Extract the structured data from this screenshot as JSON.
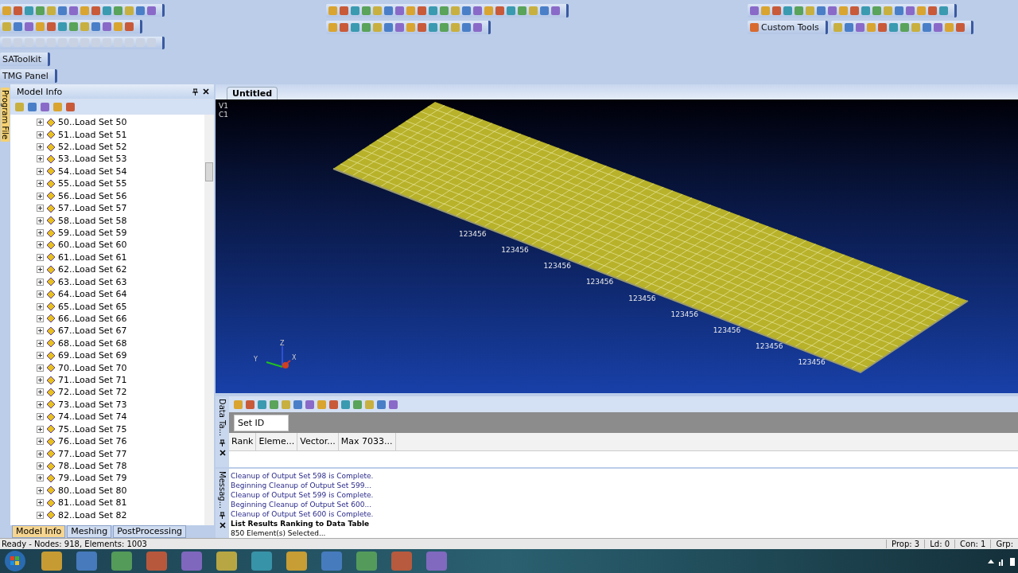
{
  "toolbars": {
    "panels": [
      "SAToolkit",
      "TMG Panel"
    ],
    "custom_tools": "Custom Tools"
  },
  "side_tab": "Program File",
  "model_info": {
    "title": "Model Info",
    "tree": [
      {
        "label": "50..Load Set 50",
        "expanded": false
      },
      {
        "label": "51..Load Set 51",
        "expanded": false
      },
      {
        "label": "52..Load Set 52",
        "expanded": false
      },
      {
        "label": "53..Load Set 53",
        "expanded": false
      },
      {
        "label": "54..Load Set 54",
        "expanded": false
      },
      {
        "label": "55..Load Set 55",
        "expanded": false
      },
      {
        "label": "56..Load Set 56",
        "expanded": false
      },
      {
        "label": "57..Load Set 57",
        "expanded": false
      },
      {
        "label": "58..Load Set 58",
        "expanded": false
      },
      {
        "label": "59..Load Set 59",
        "expanded": false
      },
      {
        "label": "60..Load Set 60",
        "expanded": false
      },
      {
        "label": "61..Load Set 61",
        "expanded": false
      },
      {
        "label": "62..Load Set 62",
        "expanded": false
      },
      {
        "label": "63..Load Set 63",
        "expanded": false
      },
      {
        "label": "64..Load Set 64",
        "expanded": false
      },
      {
        "label": "65..Load Set 65",
        "expanded": false
      },
      {
        "label": "66..Load Set 66",
        "expanded": false
      },
      {
        "label": "67..Load Set 67",
        "expanded": false
      },
      {
        "label": "68..Load Set 68",
        "expanded": false
      },
      {
        "label": "69..Load Set 69",
        "expanded": false
      },
      {
        "label": "70..Load Set 70",
        "expanded": false
      },
      {
        "label": "71..Load Set 71",
        "expanded": false
      },
      {
        "label": "72..Load Set 72",
        "expanded": false
      },
      {
        "label": "73..Load Set 73",
        "expanded": false
      },
      {
        "label": "74..Load Set 74",
        "expanded": false
      },
      {
        "label": "75..Load Set 75",
        "expanded": false
      },
      {
        "label": "76..Load Set 76",
        "expanded": false
      },
      {
        "label": "77..Load Set 77",
        "expanded": false
      },
      {
        "label": "78..Load Set 78",
        "expanded": false
      },
      {
        "label": "79..Load Set 79",
        "expanded": false
      },
      {
        "label": "80..Load Set 80",
        "expanded": false
      },
      {
        "label": "81..Load Set 81",
        "expanded": false
      },
      {
        "label": "82..Load Set 82",
        "expanded": false
      }
    ],
    "tabs": [
      {
        "label": "Model Info",
        "selected": true
      },
      {
        "label": "Meshing",
        "selected": false
      },
      {
        "label": "PostProcessing",
        "selected": false
      }
    ]
  },
  "view": {
    "tab": "Untitled",
    "labels": [
      "V1",
      "C1"
    ],
    "constraint_labels": [
      "123456",
      "123456",
      "123456",
      "123456",
      "123456",
      "123456",
      "123456",
      "123456",
      "123456"
    ],
    "axes": [
      "Z",
      "Y",
      "X"
    ]
  },
  "data_table": {
    "side_label": "Data Ta...",
    "group_button": "Set ID",
    "columns": [
      "Rank",
      "Eleme...",
      "Vector...",
      "Max 7033..."
    ]
  },
  "messages": {
    "side_label": "Messag...",
    "lines": [
      {
        "text": "Cleanup of Output Set 598 is Complete.",
        "kind": "progress"
      },
      {
        "text": "Beginning Cleanup of Output Set 599...",
        "kind": "progress"
      },
      {
        "text": "Cleanup of Output Set 599 is Complete.",
        "kind": "progress"
      },
      {
        "text": "Beginning Cleanup of Output Set 600...",
        "kind": "progress"
      },
      {
        "text": "Cleanup of Output Set 600 is Complete.",
        "kind": "progress"
      },
      {
        "text": "List Results Ranking to Data Table",
        "kind": "command"
      },
      {
        "text": "850 Element(s) Selected...",
        "kind": "result"
      }
    ]
  },
  "status_bar": {
    "text": "Ready - Nodes: 918,  Elements: 1003",
    "fields": [
      "Prop: 3",
      "Ld: 0",
      "Con: 1",
      "Grp:"
    ]
  }
}
